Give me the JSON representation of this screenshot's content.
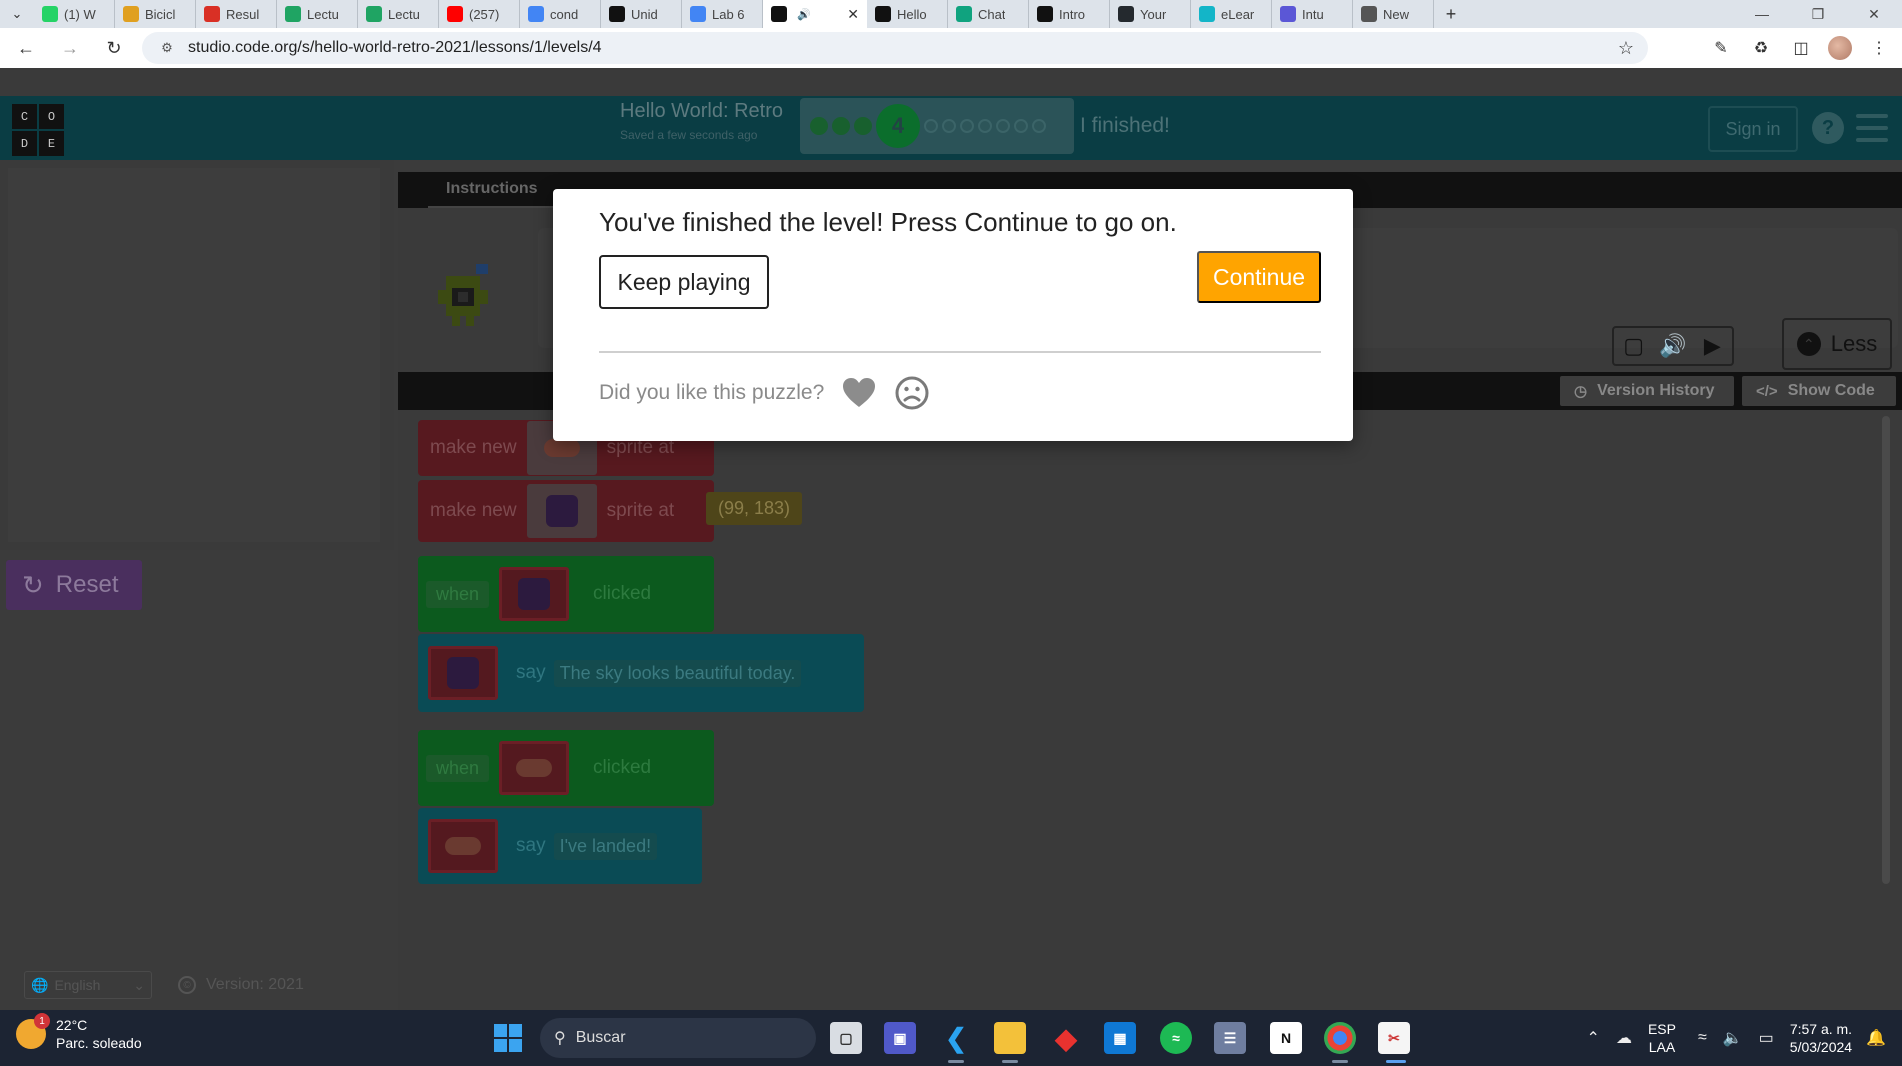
{
  "browser": {
    "tabs": [
      {
        "label": "(1) W",
        "icon": "whatsapp-icon",
        "color": "#25d366"
      },
      {
        "label": "Bicicl",
        "icon": "app-icon",
        "color": "#e0a020"
      },
      {
        "label": "Resul",
        "icon": "gmail-icon",
        "color": "#d93025"
      },
      {
        "label": "Lectu",
        "icon": "google-drive-icon",
        "color": "#1fa463"
      },
      {
        "label": "Lectu",
        "icon": "google-drive-icon",
        "color": "#1fa463"
      },
      {
        "label": "(257)",
        "icon": "youtube-icon",
        "color": "#ff0000"
      },
      {
        "label": "cond",
        "icon": "google-icon",
        "color": "#4285f4"
      },
      {
        "label": "Unid",
        "icon": "notion-icon",
        "color": "#111111"
      },
      {
        "label": "Lab 6",
        "icon": "google-docs-icon",
        "color": "#4285f4"
      },
      {
        "label": "",
        "icon": "code-org-icon",
        "color": "#111111",
        "active": true
      },
      {
        "label": "Hello",
        "icon": "code-org-icon",
        "color": "#111111"
      },
      {
        "label": "Chat",
        "icon": "chatgpt-icon",
        "color": "#10a37f"
      },
      {
        "label": "Intro",
        "icon": "notion-icon",
        "color": "#111111"
      },
      {
        "label": "Your",
        "icon": "github-icon",
        "color": "#24292e"
      },
      {
        "label": "eLear",
        "icon": "elearning-icon",
        "color": "#13b5c8"
      },
      {
        "label": "Intu",
        "icon": "settings-flower-icon",
        "color": "#5b57d6"
      },
      {
        "label": "New",
        "icon": "chrome-icon",
        "color": "#555555"
      }
    ],
    "url": "studio.code.org/s/hello-world-retro-2021/lessons/1/levels/4"
  },
  "header": {
    "logo_letters": [
      "C",
      "O",
      "D",
      "E"
    ],
    "project_title": "Hello World: Retro",
    "saved_text": "Saved a few seconds ago",
    "current_level": "4",
    "finished_text": "I finished!",
    "sign_in": "Sign in",
    "help": "?"
  },
  "instructions": {
    "tab_label": "Instructions",
    "less_label": "Less"
  },
  "workspace": {
    "version_history": "Version History",
    "show_code": "Show Code",
    "blocks": {
      "make_new_1": "make new",
      "sprite_at_1": "sprite at",
      "make_new_2": "make new",
      "sprite_at_2": "sprite at",
      "coord_2": "(99, 183)",
      "when_1": "when",
      "clicked_1": "clicked",
      "say_1": "say",
      "say_1_text": "The sky looks beautiful today.",
      "when_2": "when",
      "clicked_2": "clicked",
      "say_2": "say",
      "say_2_text": "I've landed!"
    }
  },
  "left": {
    "reset_label": "Reset",
    "language": "English",
    "version": "Version: 2021"
  },
  "dialog": {
    "title": "You've finished the level! Press Continue to go on.",
    "keep_playing": "Keep playing",
    "continue": "Continue",
    "feedback_question": "Did you like this puzzle?",
    "continue_color": "#ffa400"
  },
  "taskbar": {
    "temperature": "22°C",
    "weather_desc": "Parc. soleado",
    "weather_badge": "1",
    "search_placeholder": "Buscar",
    "lang_top": "ESP",
    "lang_bottom": "LAA",
    "time": "7:57 a. m.",
    "date": "5/03/2024"
  }
}
